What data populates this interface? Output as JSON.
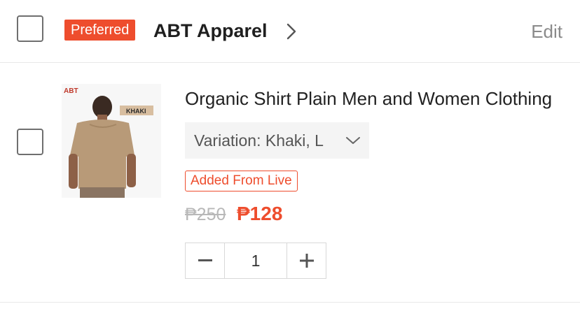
{
  "shop": {
    "badge": "Preferred",
    "name": "ABT Apparel",
    "edit_label": "Edit"
  },
  "item": {
    "title": "Organic Shirt Plain Men and Women Clothing",
    "variation": "Variation: Khaki, L",
    "tag": "Added From Live",
    "original_price": "₱250",
    "price": "₱128",
    "quantity": "1",
    "image_label": "KHAKI",
    "brand_logo_text": "ABT"
  },
  "colors": {
    "accent": "#ee4d2d",
    "shirt": "#b89a78"
  },
  "icons": [
    "chevron-right-icon",
    "chevron-down-icon",
    "minus-icon",
    "plus-icon"
  ]
}
